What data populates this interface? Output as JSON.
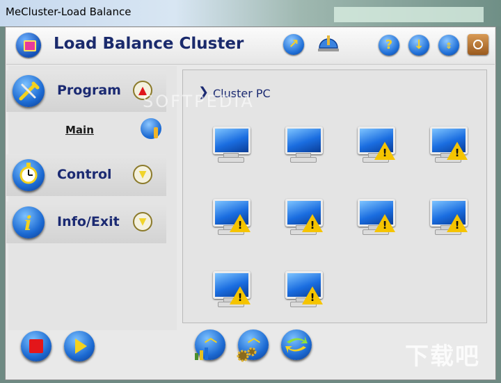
{
  "window": {
    "title": "MeCluster-Load Balance"
  },
  "header": {
    "title": "Load Balance Cluster"
  },
  "nav": {
    "program": "Program",
    "main": "Main",
    "control": "Control",
    "info_exit": "Info/Exit"
  },
  "panel": {
    "title": "Cluster PC"
  },
  "pcs": [
    {
      "warning": false
    },
    {
      "warning": false
    },
    {
      "warning": true
    },
    {
      "warning": true
    },
    {
      "warning": true
    },
    {
      "warning": true
    },
    {
      "warning": true
    },
    {
      "warning": true
    },
    {
      "warning": true
    },
    {
      "warning": true
    }
  ],
  "watermark": {
    "softpedia": "SOFTPEDIA",
    "corner": "下载吧"
  },
  "colors": {
    "accent": "#1b2a72",
    "warning": "#f5c400",
    "stop": "#e3161a"
  }
}
